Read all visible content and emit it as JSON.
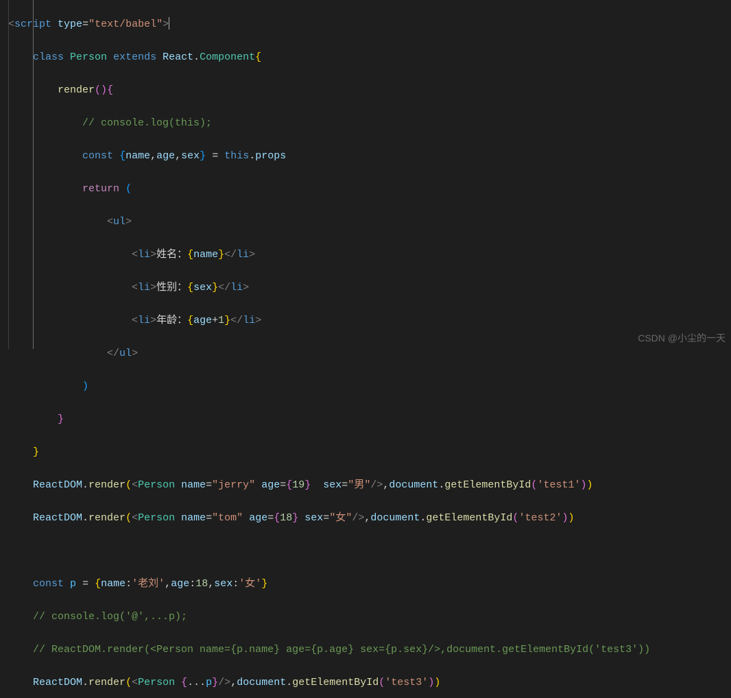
{
  "code": {
    "line1": {
      "script_tag": "script",
      "type_attr": "type",
      "type_val": "\"text/babel\""
    },
    "line2": {
      "class_kw": "class",
      "class_name": "Person",
      "extends_kw": "extends",
      "react": "React",
      "component": "Component"
    },
    "line3": {
      "render": "render"
    },
    "line4": {
      "comment": "// console.log(this);"
    },
    "line5": {
      "const_kw": "const",
      "name": "name",
      "age": "age",
      "sex": "sex",
      "this_kw": "this",
      "props": "props"
    },
    "line6": {
      "return_kw": "return"
    },
    "line7": {
      "ul": "ul"
    },
    "line8": {
      "li": "li",
      "text": "姓名：",
      "var": "name"
    },
    "line9": {
      "li": "li",
      "text": "性别：",
      "var": "sex"
    },
    "line10": {
      "li": "li",
      "text": "年龄：",
      "var": "age",
      "plus": "+",
      "one": "1"
    },
    "line11": {
      "ul": "ul"
    },
    "line15": {
      "reactdom": "ReactDOM",
      "render": "render",
      "person": "Person",
      "name_attr": "name",
      "name_val": "\"jerry\"",
      "age_attr": "age",
      "age_val": "19",
      "sex_attr": "sex",
      "sex_val": "\"男\"",
      "document": "document",
      "getelem": "getElementById",
      "id": "'test1'"
    },
    "line16": {
      "reactdom": "ReactDOM",
      "render": "render",
      "person": "Person",
      "name_attr": "name",
      "name_val": "\"tom\"",
      "age_attr": "age",
      "age_val": "18",
      "sex_attr": "sex",
      "sex_val": "\"女\"",
      "document": "document",
      "getelem": "getElementById",
      "id": "'test2'"
    },
    "line18": {
      "const_kw": "const",
      "p": "p",
      "name_key": "name",
      "name_val": "'老刘'",
      "age_key": "age",
      "age_val": "18",
      "sex_key": "sex",
      "sex_val": "'女'"
    },
    "line19": {
      "comment": "// console.log('@',...p);"
    },
    "line20": {
      "comment": "// ReactDOM.render(<Person name={p.name} age={p.age} sex={p.sex}/>,document.getElementById('test3'))"
    },
    "line21": {
      "reactdom": "ReactDOM",
      "render": "render",
      "person": "Person",
      "p": "p",
      "document": "document",
      "getelem": "getElementById",
      "id": "'test3'"
    }
  },
  "watermark": "CSDN @小尘的一天"
}
